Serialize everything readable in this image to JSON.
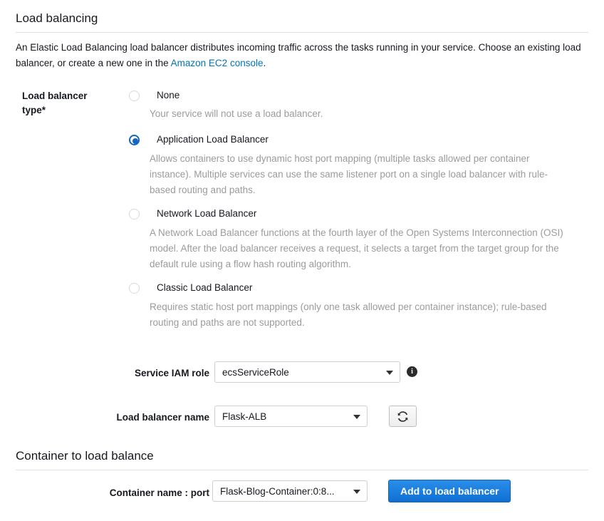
{
  "load_balancing": {
    "heading": "Load balancing",
    "description_part1": "An Elastic Load Balancing load balancer distributes incoming traffic across the tasks running in your service. Choose an existing load balancer, or create a new one in the ",
    "link_text": "Amazon EC2 console",
    "description_part2": "."
  },
  "lb_type": {
    "label": "Load balancer type*",
    "label_line1": "Load balancer",
    "label_line2": "type*",
    "selected": "Application Load Balancer",
    "options": [
      {
        "title": "None",
        "description": "Your service will not use a load balancer.",
        "selected": false
      },
      {
        "title": "Application Load Balancer",
        "description": "Allows containers to use dynamic host port mapping (multiple tasks allowed per container instance). Multiple services can use the same listener port on a single load balancer with rule-based routing and paths.",
        "selected": true
      },
      {
        "title": "Network Load Balancer",
        "description": "A Network Load Balancer functions at the fourth layer of the Open Systems Interconnection (OSI) model. After the load balancer receives a request, it selects a target from the target group for the default rule using a flow hash routing algorithm.",
        "selected": false
      },
      {
        "title": "Classic Load Balancer",
        "description": "Requires static host port mappings (only one task allowed per container instance); rule-based routing and paths are not supported.",
        "selected": false
      }
    ]
  },
  "service_iam_role": {
    "label": "Service IAM role",
    "value": "ecsServiceRole",
    "info_glyph": "i"
  },
  "load_balancer_name": {
    "label": "Load balancer name",
    "value": "Flask-ALB",
    "refresh_title": "Refresh"
  },
  "container_section": {
    "heading": "Container to load balance",
    "container_label": "Container name : port",
    "container_value": "Flask-Blog-Container:0:8...",
    "add_button": "Add to load balancer"
  },
  "colors": {
    "link": "#0073bb",
    "accent": "#1565c0",
    "primary_button": "#1073d6",
    "muted_text": "#9b9b9b",
    "divider": "#e0e0e0"
  }
}
